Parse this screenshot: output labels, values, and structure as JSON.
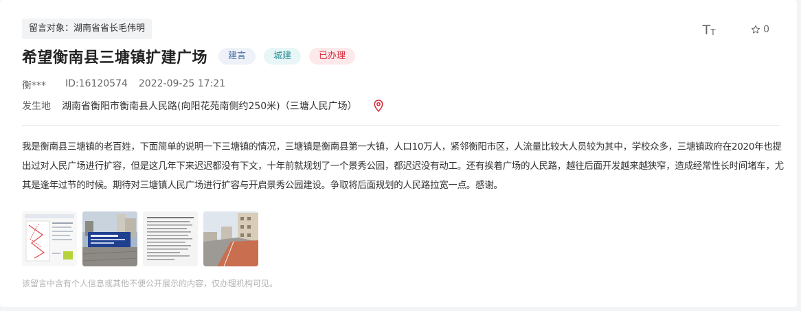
{
  "message": {
    "target": "留言对象：湖南省省长毛伟明",
    "title": "希望衡南县三塘镇扩建广场",
    "tags": {
      "type": "建言",
      "domain": "城建",
      "status": "已办理"
    },
    "author": "衡***",
    "id": "ID:16120574",
    "datetime": "2022-09-25 17:21",
    "location_label": "发生地",
    "location_value": "湖南省衡阳市衡南县人民路(向阳花苑南侧约250米)（三塘人民广场）",
    "content": "我是衡南县三塘镇的老百姓，下面简单的说明一下三塘镇的情况，三塘镇是衡南县第一大镇，人口10万人，紧邻衡阳市区，人流量比较大人员较为其中，学校众多，三塘镇政府在2020年也提出过对人民广场进行扩容，但是这几年下来迟迟都没有下文，十年前就规划了一个景秀公园，都迟迟没有动工。还有挨着广场的人民路，越往后面开发越来越狭窄，造成经常性长时间堵车，尤其是逢年过节的时候。期待对三塘镇人民广场进行扩容与开启景秀公园建设。争取将后面规划的人民路拉宽一点。感谢。",
    "privacy_note": "该留言中含有个人信息或其他不便公开展示的内容，仅办理机构可见。"
  },
  "toolbar": {
    "font_size_big": "T",
    "font_size_small": "T",
    "favorite_count": "0"
  },
  "icons": {
    "font_size": "font-size-icon",
    "favorite": "star-icon",
    "location": "location-pin-icon"
  },
  "colors": {
    "location_pin": "#d9303e",
    "status_badge": "#d9303e",
    "domain_badge": "#2c8f9a",
    "type_badge": "#4a6fa5"
  },
  "attachments": [
    {
      "kind": "document-scan-map"
    },
    {
      "kind": "photo-banner-buildings"
    },
    {
      "kind": "document-scan-text"
    },
    {
      "kind": "photo-road-buildings"
    }
  ]
}
